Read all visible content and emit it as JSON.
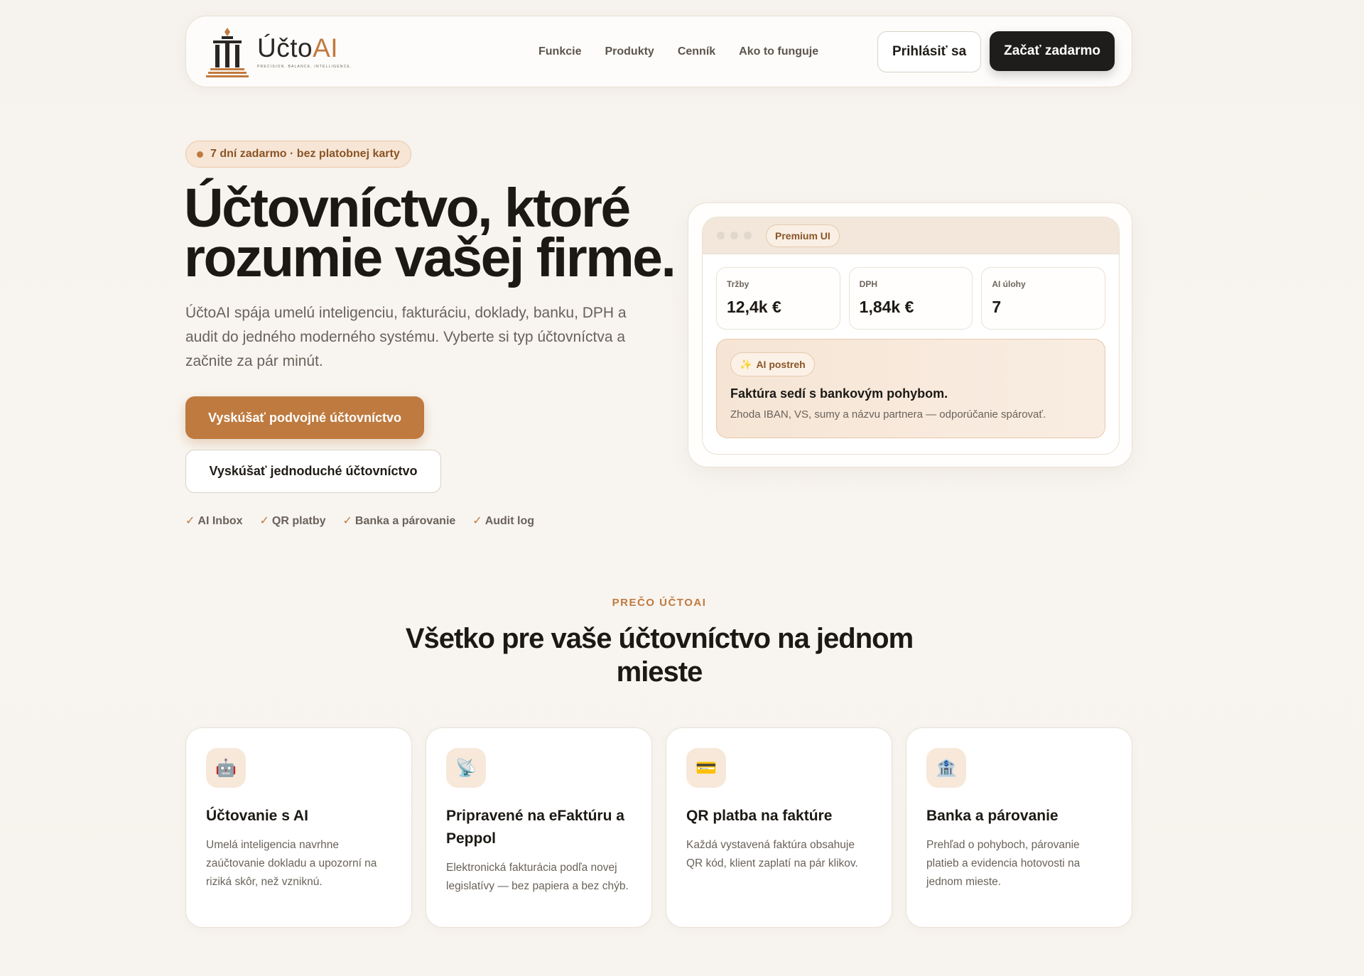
{
  "nav": {
    "brand_prefix": "Účto",
    "brand_ai": "AI",
    "brand_tagline": "PRECISION. BALANCE. INTELLIGENCE.",
    "links": [
      "Funkcie",
      "Produkty",
      "Cenník",
      "Ako to funguje"
    ],
    "login_label": "Prihlásiť sa",
    "start_label": "Začať zadarmo"
  },
  "hero": {
    "badge": "7 dní zadarmo · bez platobnej karty",
    "title_line1": "Účtovníctvo, ktoré",
    "title_line2": "rozumie vašej firme.",
    "subtitle": "ÚčtoAI spája umelú inteligenciu, fakturáciu, doklady, banku, DPH a audit do jedného moderného systému. Vyberte si typ účtovníctva a začnite za pár minút.",
    "primary_cta": "Vyskúšať podvojné účtovníctvo",
    "secondary_cta": "Vyskúšať jednoduché účtovníctvo",
    "features": [
      "AI Inbox",
      "QR platby",
      "Banka a párovanie",
      "Audit log"
    ]
  },
  "preview": {
    "pill": "Premium UI",
    "stats": [
      {
        "label": "Tržby",
        "value": "12,4k €"
      },
      {
        "label": "DPH",
        "value": "1,84k €"
      },
      {
        "label": "AI úlohy",
        "value": "7"
      }
    ],
    "insight_pill": "AI postreh",
    "insight_title": "Faktúra sedí s bankovým pohybom.",
    "insight_text": "Zhoda IBAN, VS, sumy a názvu partnera — odporúčanie spárovať."
  },
  "section": {
    "eyebrow": "PREČO ÚČTOAI",
    "title": "Všetko pre vaše účtovníctvo na jednom mieste",
    "cards": [
      {
        "icon": "robot-icon",
        "glyph": "🤖",
        "title": "Účtovanie s AI",
        "text": "Umelá inteligencia navrhne zaúčtovanie dokladu a upozorní na riziká skôr, než vzniknú."
      },
      {
        "icon": "satellite-dish-icon",
        "glyph": "📡",
        "title": "Pripravené na eFaktúru a Peppol",
        "text": "Elektronická fakturácia podľa novej legislatívy — bez papiera a bez chýb."
      },
      {
        "icon": "credit-card-icon",
        "glyph": "💳",
        "title": "QR platba na faktúre",
        "text": "Každá vystavená faktúra obsahuje QR kód, klient zaplatí na pár klikov."
      },
      {
        "icon": "bank-icon",
        "glyph": "🏦",
        "title": "Banka a párovanie",
        "text": "Prehľad o pohyboch, párovanie platieb a evidencia hotovosti na jednom mieste."
      }
    ]
  },
  "colors": {
    "accent": "#bf7a3f",
    "dark": "#1f1d1b",
    "background": "#f7f3ee"
  }
}
